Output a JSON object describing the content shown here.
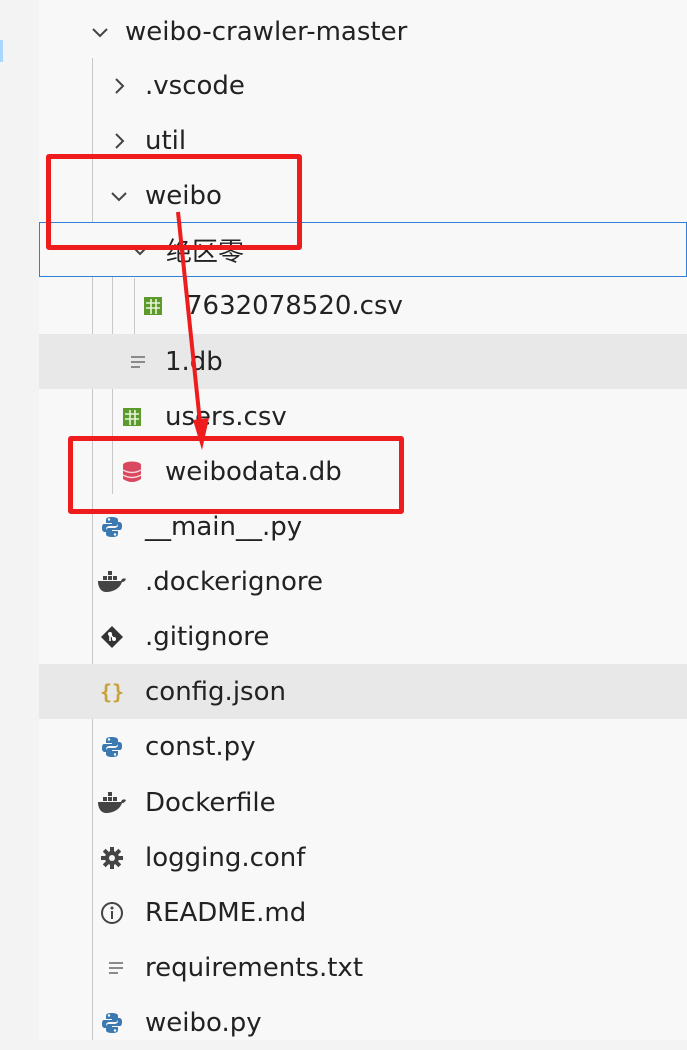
{
  "explorer": {
    "root": {
      "label": "weibo-crawler-master"
    },
    "items": [
      {
        "label": ".vscode"
      },
      {
        "label": "util"
      },
      {
        "label": "weibo"
      },
      {
        "label": "绝区零"
      },
      {
        "label": "7632078520.csv"
      },
      {
        "label": "1.db"
      },
      {
        "label": "users.csv"
      },
      {
        "label": "weibodata.db"
      },
      {
        "label": "__main__.py"
      },
      {
        "label": ".dockerignore"
      },
      {
        "label": ".gitignore"
      },
      {
        "label": "config.json"
      },
      {
        "label": "const.py"
      },
      {
        "label": "Dockerfile"
      },
      {
        "label": "logging.conf"
      },
      {
        "label": "README.md"
      },
      {
        "label": "requirements.txt"
      },
      {
        "label": "weibo.py"
      }
    ]
  },
  "icons": {
    "folder_expanded": "chevron-down-icon",
    "folder_collapsed": "chevron-right-icon",
    "csv": "table-icon",
    "text": "lines-icon",
    "database": "database-icon",
    "python": "python-icon",
    "docker": "docker-icon",
    "git": "git-icon",
    "json": "braces-icon",
    "config": "gear-icon",
    "readme": "info-icon"
  },
  "colors": {
    "annotation": "#ee1c1c",
    "focus_border": "#2f80d8",
    "python": "#3b79b0",
    "csv": "#5c9a2c",
    "database": "#d9485f",
    "json": "#c8a13a",
    "hover_row": "#e8e8e8"
  }
}
